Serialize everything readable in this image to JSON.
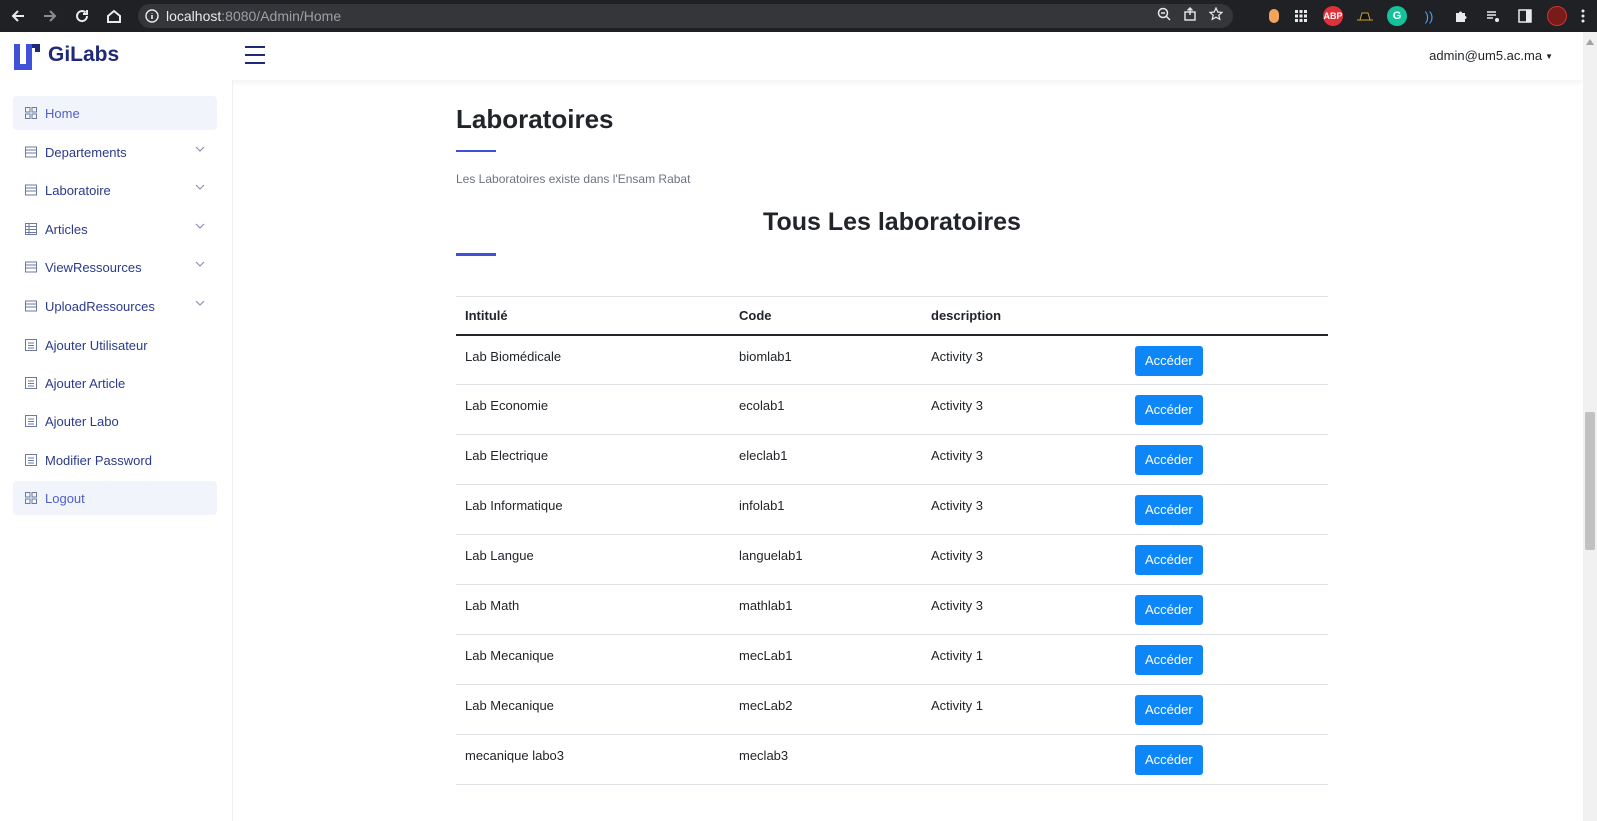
{
  "browser": {
    "url_host": "localhost",
    "url_rest": ":8080/Admin/Home",
    "extensions": [
      "ABP"
    ]
  },
  "header": {
    "brand": "GiLabs",
    "user": "admin@um5.ac.ma"
  },
  "sidebar": {
    "items": [
      {
        "label": "Home",
        "icon": "grid-icon",
        "active": true
      },
      {
        "label": "Departements",
        "icon": "list-icon",
        "expandable": true
      },
      {
        "label": "Laboratoire",
        "icon": "list-icon",
        "expandable": true
      },
      {
        "label": "Articles",
        "icon": "table-icon",
        "expandable": true
      },
      {
        "label": "ViewRessources",
        "icon": "list-icon",
        "expandable": true
      },
      {
        "label": "UploadRessources",
        "icon": "list-icon",
        "expandable": true
      },
      {
        "label": "Ajouter Utilisateur",
        "icon": "form-icon"
      },
      {
        "label": "Ajouter Article",
        "icon": "form-icon"
      },
      {
        "label": "Ajouter Labo",
        "icon": "form-icon"
      },
      {
        "label": "Modifier Password",
        "icon": "form-icon"
      },
      {
        "label": "Logout",
        "icon": "grid-icon",
        "active": true
      }
    ]
  },
  "main": {
    "title": "Laboratoires",
    "subtitle": "Les Laboratoires existe dans l'Ensam Rabat",
    "section_title": "Tous Les laboratoires",
    "table": {
      "headers": [
        "Intitulé",
        "Code",
        "description",
        ""
      ],
      "button_label": "Accéder",
      "rows": [
        [
          "Lab Biomédicale",
          "biomlab1",
          "Activity 3"
        ],
        [
          "Lab Economie",
          "ecolab1",
          "Activity 3"
        ],
        [
          "Lab Electrique",
          "eleclab1",
          "Activity 3"
        ],
        [
          "Lab Informatique",
          "infolab1",
          "Activity 3"
        ],
        [
          "Lab Langue",
          "languelab1",
          "Activity 3"
        ],
        [
          "Lab Math",
          "mathlab1",
          "Activity 3"
        ],
        [
          "Lab Mecanique",
          "mecLab1",
          "Activity 1"
        ],
        [
          "Lab Mecanique",
          "mecLab2",
          "Activity 1"
        ],
        [
          "mecanique labo3",
          "meclab3",
          ""
        ]
      ]
    }
  },
  "colors": {
    "brand": "#1e2a78",
    "accent": "#3f51d6",
    "button": "#0d87f8"
  }
}
